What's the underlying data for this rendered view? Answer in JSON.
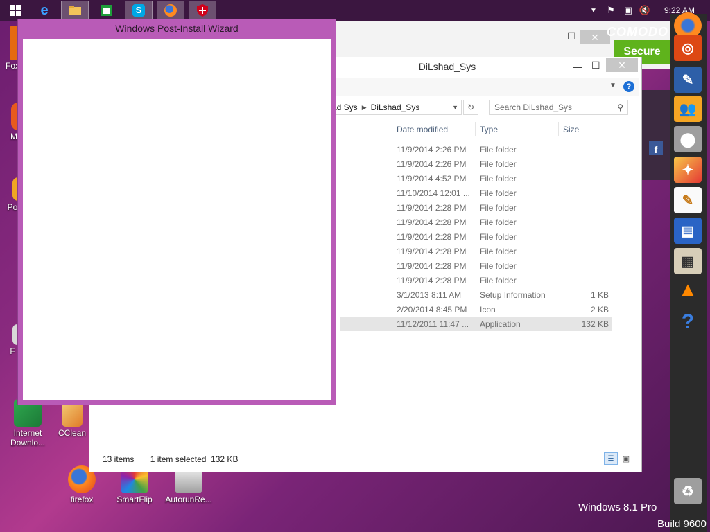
{
  "taskbar": {
    "buttons": [
      {
        "name": "start-button",
        "icon": "windows-logo-icon"
      },
      {
        "name": "ie-button",
        "icon": "internet-explorer-icon"
      },
      {
        "name": "file-explorer-button",
        "icon": "folder-icon"
      },
      {
        "name": "store-button",
        "icon": "store-icon"
      },
      {
        "name": "skype-button",
        "icon": "skype-icon"
      },
      {
        "name": "firefox-button",
        "icon": "firefox-icon"
      },
      {
        "name": "comodo-button",
        "icon": "shield-icon"
      }
    ],
    "clock": "9:22 AM"
  },
  "desktop": {
    "icons": [
      {
        "label": "Fox"
      },
      {
        "label": "M"
      },
      {
        "label": "Po"
      },
      {
        "label": "F"
      },
      {
        "label": "Internet Downlo..."
      },
      {
        "label": "CClean"
      },
      {
        "label": "firefox"
      },
      {
        "label": "SmartFlip"
      },
      {
        "label": "AutorunRe..."
      }
    ]
  },
  "comodo": {
    "brand": "COMODO",
    "secure_label": "Secure"
  },
  "explorer": {
    "title": "DiLshad_Sys",
    "address": {
      "parent": "ad Sys",
      "current": "DiLshad_Sys"
    },
    "search_placeholder": "Search DiLshad_Sys",
    "columns": {
      "date": "Date modified",
      "type": "Type",
      "size": "Size"
    },
    "rows": [
      {
        "date": "11/9/2014 2:26 PM",
        "type": "File folder",
        "size": ""
      },
      {
        "date": "11/9/2014 2:26 PM",
        "type": "File folder",
        "size": ""
      },
      {
        "date": "11/9/2014 4:52 PM",
        "type": "File folder",
        "size": ""
      },
      {
        "date": "11/10/2014 12:01 ...",
        "type": "File folder",
        "size": ""
      },
      {
        "date": "11/9/2014 2:28 PM",
        "type": "File folder",
        "size": ""
      },
      {
        "date": "11/9/2014 2:28 PM",
        "type": "File folder",
        "size": ""
      },
      {
        "date": "11/9/2014 2:28 PM",
        "type": "File folder",
        "size": ""
      },
      {
        "date": "11/9/2014 2:28 PM",
        "type": "File folder",
        "size": ""
      },
      {
        "date": "11/9/2014 2:28 PM",
        "type": "File folder",
        "size": ""
      },
      {
        "date": "11/9/2014 2:28 PM",
        "type": "File folder",
        "size": ""
      },
      {
        "date": "3/1/2013 8:11 AM",
        "type": "Setup Information",
        "size": "1 KB"
      },
      {
        "date": "2/20/2014 8:45 PM",
        "type": "Icon",
        "size": "2 KB"
      },
      {
        "date": "11/12/2011 11:47 ...",
        "type": "Application",
        "size": "132 KB",
        "selected": true
      }
    ],
    "status": {
      "count": "13 items",
      "selection": "1 item selected  132 KB"
    }
  },
  "wizard": {
    "title": "Windows Post-Install Wizard"
  },
  "watermark": {
    "line1": "Windows 8.1 Pro",
    "line2": "Build 9600"
  },
  "colors": {
    "wizard_frame": "#b95bb7",
    "comodo_green": "#5fb31c",
    "accent_blue": "#1c6fd6"
  }
}
